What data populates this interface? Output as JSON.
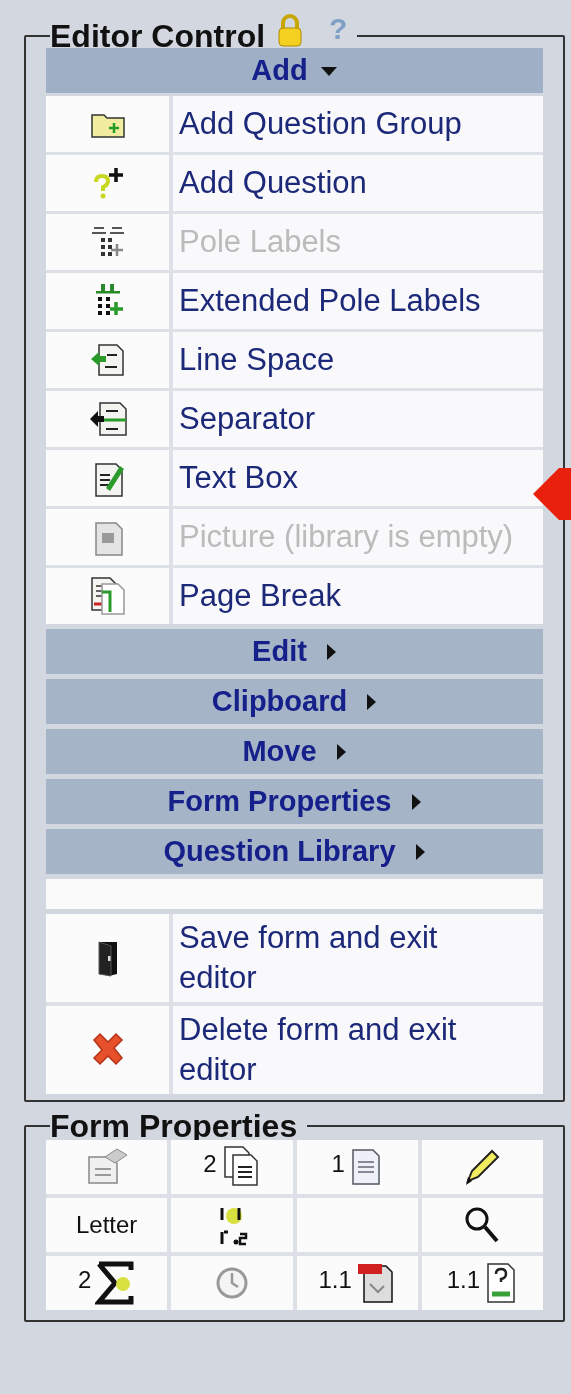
{
  "editor_control": {
    "title": "Editor Control",
    "locked": true,
    "help": "?",
    "sections": [
      {
        "label": "Add",
        "expanded": true,
        "items": [
          {
            "label": "Add Question Group",
            "disabled": false
          },
          {
            "label": "Add Question",
            "disabled": false
          },
          {
            "label": "Pole Labels",
            "disabled": true
          },
          {
            "label": "Extended Pole Labels",
            "disabled": false
          },
          {
            "label": "Line Space",
            "disabled": false
          },
          {
            "label": "Separator",
            "disabled": false
          },
          {
            "label": "Text Box",
            "disabled": false
          },
          {
            "label": "Picture (library is empty)",
            "disabled": true
          },
          {
            "label": "Page Break",
            "disabled": false
          }
        ]
      },
      {
        "label": "Edit",
        "expanded": false
      },
      {
        "label": "Clipboard",
        "expanded": false
      },
      {
        "label": "Move",
        "expanded": false
      },
      {
        "label": "Form Properties",
        "expanded": false
      },
      {
        "label": "Question Library",
        "expanded": false
      }
    ],
    "actions": [
      {
        "label": "Save form and exit editor"
      },
      {
        "label": "Delete form and exit editor"
      }
    ]
  },
  "form_properties": {
    "title": "Form Properties",
    "cells": [
      {
        "kind": "icon"
      },
      {
        "kind": "count",
        "label": "2"
      },
      {
        "kind": "count",
        "label": "1"
      },
      {
        "kind": "icon"
      },
      {
        "kind": "text",
        "label": "Letter"
      },
      {
        "kind": "icon"
      },
      {
        "kind": "blank"
      },
      {
        "kind": "icon"
      },
      {
        "kind": "count",
        "label": "2"
      },
      {
        "kind": "icon"
      },
      {
        "kind": "count",
        "label": "1.1"
      },
      {
        "kind": "count",
        "label": "1.1"
      }
    ]
  }
}
